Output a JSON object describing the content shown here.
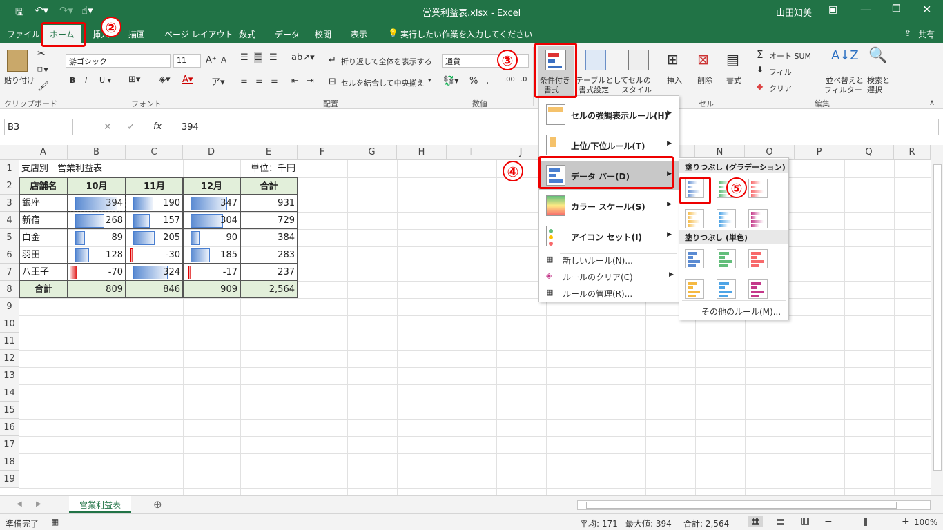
{
  "title": {
    "file": "営業利益表.xlsx - Excel",
    "user": "山田知美"
  },
  "tabs": [
    "ファイル",
    "ホーム",
    "挿入",
    "描画",
    "ページ レイアウト",
    "数式",
    "データ",
    "校閲",
    "表示"
  ],
  "tell_me": "実行したい作業を入力してください",
  "share": "共有",
  "ribbon": {
    "paste": "貼り付け",
    "clipboard": "クリップボード",
    "font_name": "游ゴシック",
    "font_size": "11",
    "font_group": "フォント",
    "wrap_text": "折り返して全体を表示する",
    "merge_center": "セルを結合して中央揃え",
    "alignment": "配置",
    "number_format": "通貨",
    "number_group": "数値",
    "cond_fmt_1": "条件付き",
    "cond_fmt_2": "書式",
    "table_fmt_1": "テーブルとして",
    "table_fmt_2": "書式設定",
    "cell_style_1": "セルの",
    "cell_style_2": "スタイル",
    "insert": "挿入",
    "delete": "削除",
    "format": "書式",
    "cells_group": "セル",
    "autosum": "オート SUM",
    "fill": "フィル",
    "clear": "クリア",
    "sort_1": "並べ替えと",
    "sort_2": "フィルター",
    "find_1": "検索と",
    "find_2": "選択",
    "editing": "編集"
  },
  "formula_bar": {
    "name_box": "B3",
    "value": "394",
    "fx": "fx"
  },
  "columns": [
    "A",
    "B",
    "C",
    "D",
    "E",
    "F",
    "G",
    "H",
    "I",
    "J",
    "K",
    "L",
    "M",
    "N",
    "O",
    "P",
    "Q",
    "R"
  ],
  "rows": [
    "1",
    "2",
    "3",
    "4",
    "5",
    "6",
    "7",
    "8",
    "9",
    "10",
    "11",
    "12",
    "13",
    "14",
    "15",
    "16",
    "17",
    "18",
    "19"
  ],
  "sheet": {
    "a1": "支店別　営業利益表",
    "e1": "単位：千円",
    "headers": [
      "店舗名",
      "10月",
      "11月",
      "12月",
      "合計"
    ],
    "data": [
      [
        "銀座",
        "394",
        "190",
        "347",
        "931"
      ],
      [
        "新宿",
        "268",
        "157",
        "304",
        "729"
      ],
      [
        "白金",
        "89",
        "205",
        "90",
        "384"
      ],
      [
        "羽田",
        "128",
        "-30",
        "185",
        "283"
      ],
      [
        "八王子",
        "-70",
        "324",
        "-17",
        "237"
      ]
    ],
    "total": [
      "合計",
      "809",
      "846",
      "909",
      "2,564"
    ],
    "bar_fraction": [
      [
        0.85,
        0.41,
        0.75
      ],
      [
        0.58,
        0.34,
        0.66
      ],
      [
        0.19,
        0.44,
        0.19
      ],
      [
        0.28,
        -0.06,
        0.4
      ],
      [
        -0.15,
        0.7,
        -0.04
      ]
    ]
  },
  "cf_menu": {
    "items": [
      {
        "label": "セルの強調表示ルール(H)"
      },
      {
        "label": "上位/下位ルール(T)"
      },
      {
        "label": "データ バー(D)"
      },
      {
        "label": "カラー スケール(S)"
      },
      {
        "label": "アイコン セット(I)"
      }
    ],
    "new_rule": "新しいルール(N)...",
    "clear_rule": "ルールのクリア(C)",
    "manage_rule": "ルールの管理(R)..."
  },
  "databar_menu": {
    "gradient": "塗りつぶし (グラデーション)",
    "solid": "塗りつぶし (単色)",
    "more": "その他のルール(M)..."
  },
  "callouts": [
    "②",
    "③",
    "④",
    "⑤"
  ],
  "sheet_tab": "営業利益表",
  "status": {
    "ready": "準備完了",
    "average": "平均: 171",
    "max": "最大値: 394",
    "sum": "合計: 2,564",
    "zoom": "100%"
  },
  "colors": {
    "accent": "#217346",
    "highlight": "#e00000",
    "bar_blue": "#5b8bd2"
  }
}
